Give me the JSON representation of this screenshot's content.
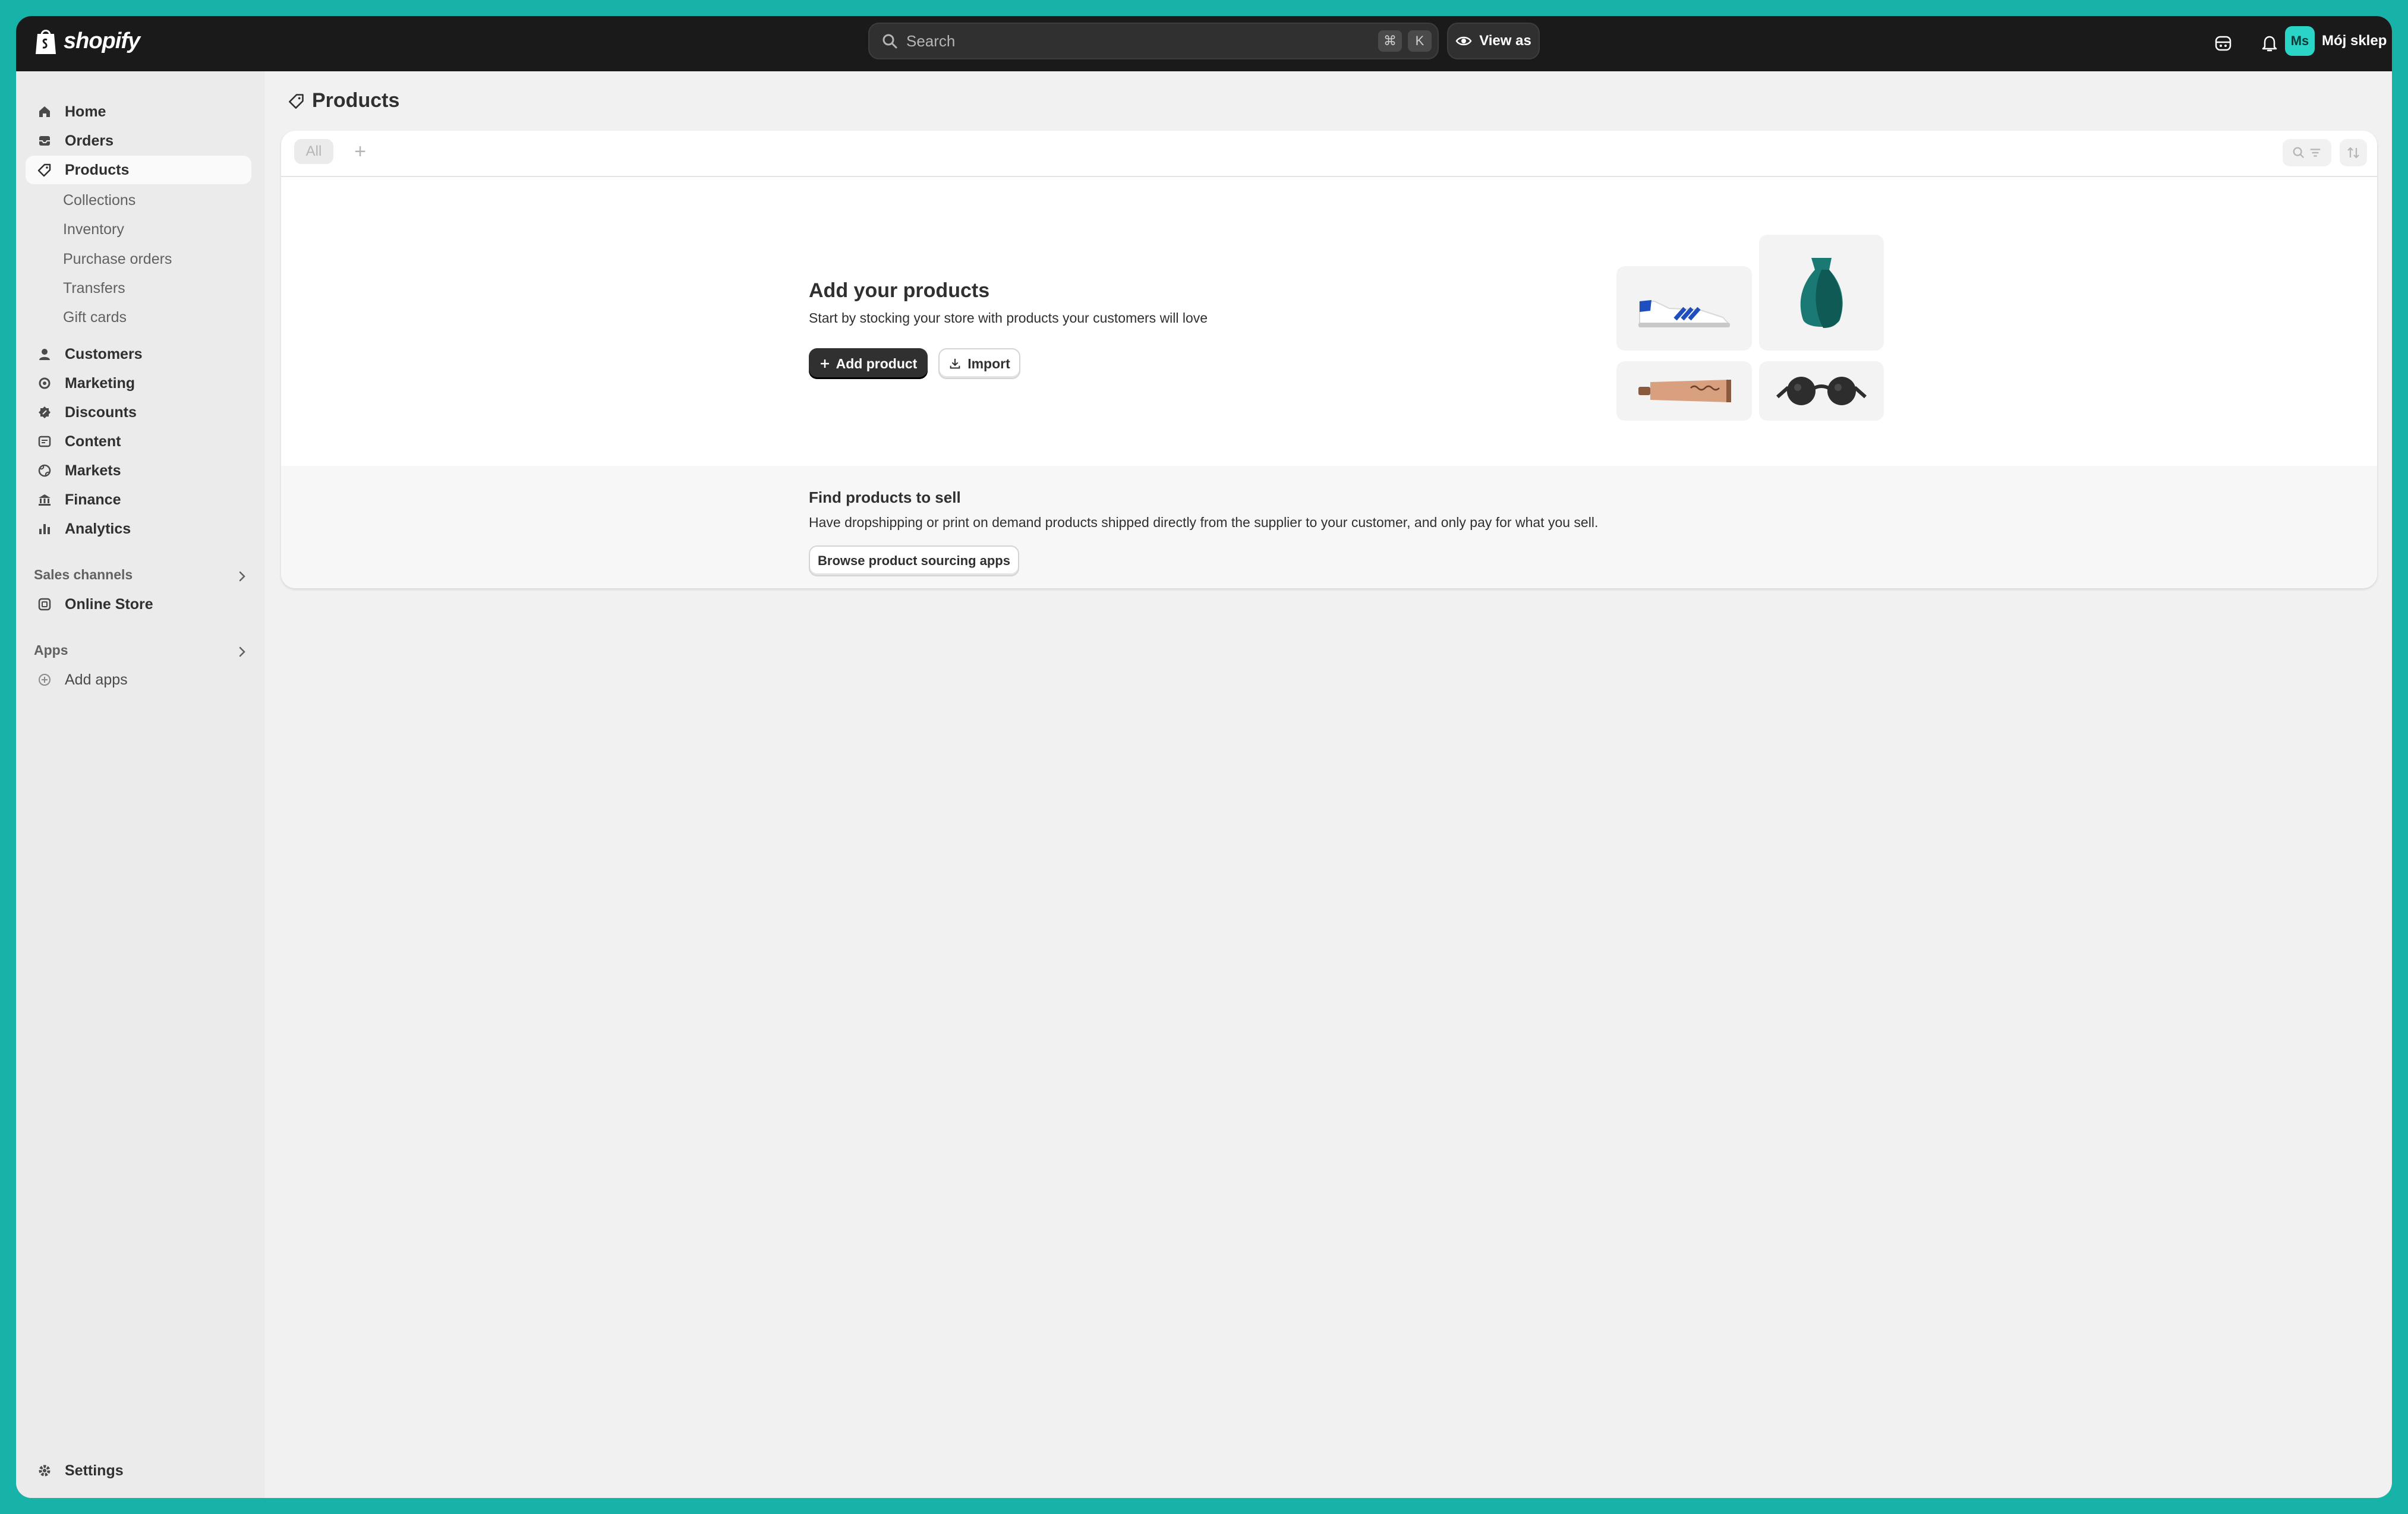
{
  "brand": {
    "name": "shopify"
  },
  "search": {
    "placeholder": "Search",
    "shortcut_cmd": "⌘",
    "shortcut_key": "K"
  },
  "topbar": {
    "view_as": "View as",
    "avatar_initials": "Ms",
    "store_name": "Mój sklep"
  },
  "sidebar": {
    "main_items": [
      {
        "label": "Home",
        "icon": "home-icon"
      },
      {
        "label": "Orders",
        "icon": "orders-icon"
      },
      {
        "label": "Products",
        "icon": "tag-icon",
        "active": true
      },
      {
        "label": "Customers",
        "icon": "person-icon"
      },
      {
        "label": "Marketing",
        "icon": "marketing-icon"
      },
      {
        "label": "Discounts",
        "icon": "discount-icon"
      },
      {
        "label": "Content",
        "icon": "content-icon"
      },
      {
        "label": "Markets",
        "icon": "globe-icon"
      },
      {
        "label": "Finance",
        "icon": "bank-icon"
      },
      {
        "label": "Analytics",
        "icon": "chart-icon"
      }
    ],
    "product_subitems": [
      "Collections",
      "Inventory",
      "Purchase orders",
      "Transfers",
      "Gift cards"
    ],
    "sales_channels": {
      "title": "Sales channels",
      "items": [
        {
          "label": "Online Store",
          "icon": "store-icon"
        }
      ]
    },
    "apps": {
      "title": "Apps",
      "items": [
        {
          "label": "Add apps",
          "icon": "plus-circle-icon"
        }
      ]
    },
    "settings": "Settings"
  },
  "page": {
    "title": "Products"
  },
  "tabs": {
    "all": "All",
    "add": "+"
  },
  "empty_state": {
    "title": "Add your products",
    "subtitle": "Start by stocking your store with products your customers will love",
    "add_product": "Add product",
    "import": "Import"
  },
  "find_products": {
    "title": "Find products to sell",
    "subtitle": "Have dropshipping or print on demand products shipped directly from the supplier to your customer, and only pay for what you sell.",
    "button": "Browse product sourcing apps"
  },
  "colors": {
    "topbar": "#1a1a1a",
    "accent_avatar": "#2ad5c7",
    "backdrop": "#17b3a8"
  }
}
